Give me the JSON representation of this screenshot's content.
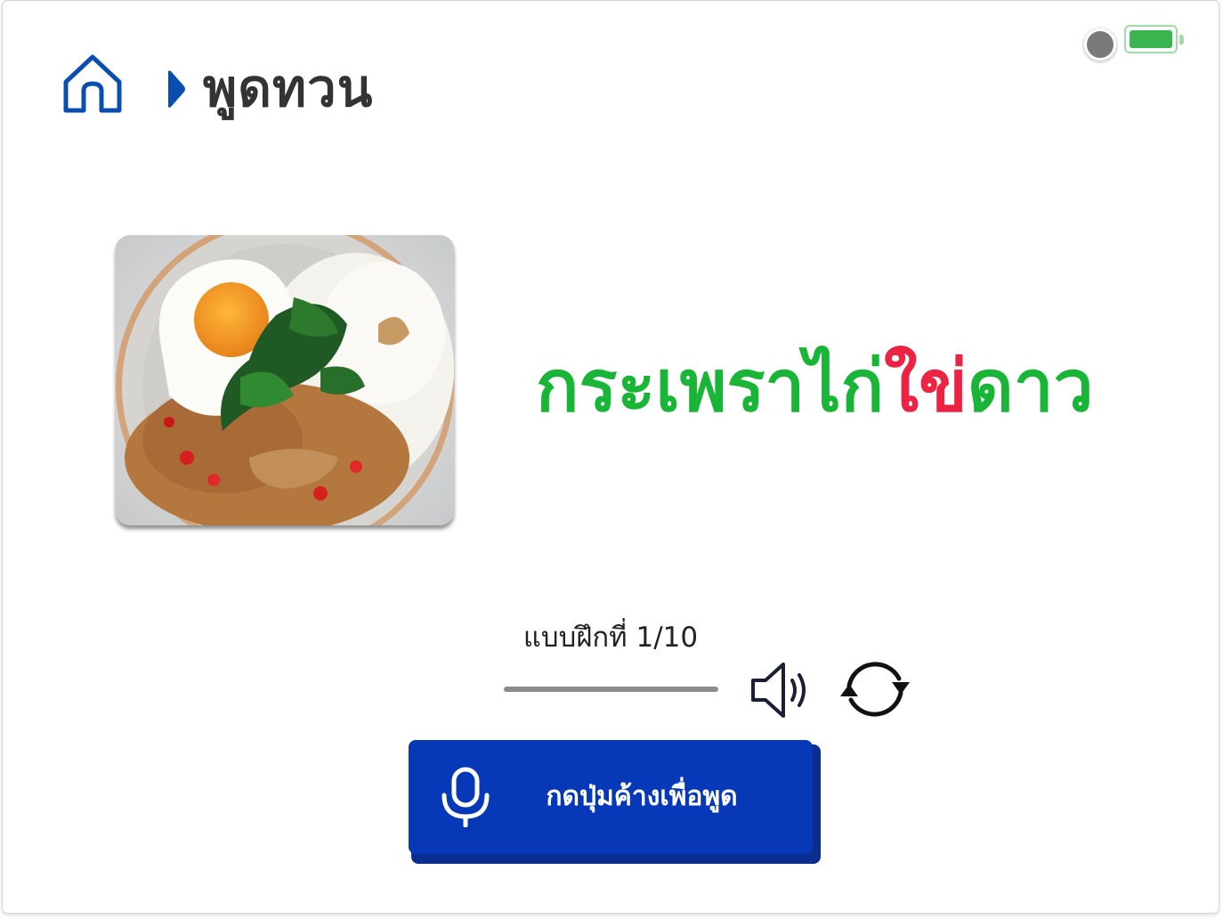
{
  "header": {
    "home_icon": "home-icon",
    "breadcrumb_icon": "triangle-right-icon",
    "title": "พูดทวน"
  },
  "status": {
    "dot_color": "#7a7a7a",
    "battery_icon": "battery-full-icon",
    "battery_color": "#3ab44f"
  },
  "card": {
    "image_subject": "food-photo",
    "word_parts": [
      {
        "text": "กระเพราไก่",
        "color": "#19b536"
      },
      {
        "text": "ใข่",
        "color": "#ec2342"
      },
      {
        "text": "ดาว",
        "color": "#19b536"
      }
    ]
  },
  "exercise": {
    "label": "แบบฝึกที่ 1/10",
    "progress_fraction": 1.0
  },
  "controls": {
    "speaker_icon": "speaker-icon",
    "refresh_icon": "refresh-icon"
  },
  "record_button": {
    "icon": "microphone-icon",
    "label": "กดปุ่มค้างเพื่อพูด",
    "color": "#0638b8"
  }
}
